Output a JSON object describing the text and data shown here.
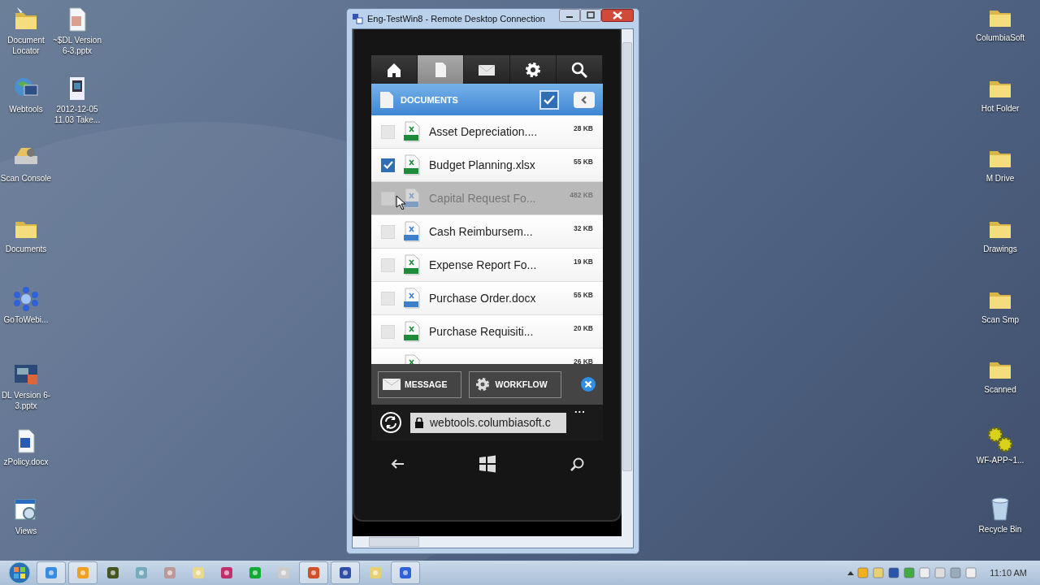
{
  "desktop_icons_left": [
    {
      "label": "Document Locator",
      "kind": "folder-arrow"
    },
    {
      "label": "~$DL Version 6-3.pptx",
      "kind": "pptx-ghost"
    },
    {
      "label": "Webtools",
      "kind": "globe"
    },
    {
      "label": "2012-12-05 11.03 Take...",
      "kind": "video"
    },
    {
      "label": "Scan Console",
      "kind": "scanner"
    },
    {
      "label": "Documents",
      "kind": "folder"
    },
    {
      "label": "GoToWebi...",
      "kind": "flower"
    },
    {
      "label": "DL Version 6-3.pptx",
      "kind": "slides"
    },
    {
      "label": "zPolicy.docx",
      "kind": "word"
    },
    {
      "label": "Views",
      "kind": "views"
    }
  ],
  "desktop_icons_right": [
    {
      "label": "ColumbiaSoft",
      "kind": "folder"
    },
    {
      "label": "Hot Folder",
      "kind": "folder"
    },
    {
      "label": "M Drive",
      "kind": "folder"
    },
    {
      "label": "Drawings",
      "kind": "folder"
    },
    {
      "label": "Scan Smp",
      "kind": "folder"
    },
    {
      "label": "Scanned",
      "kind": "folder"
    },
    {
      "label": "WF-APP~1...",
      "kind": "gears"
    },
    {
      "label": "Recycle Bin",
      "kind": "bin"
    }
  ],
  "window": {
    "title": "Eng-TestWin8 - Remote Desktop Connection",
    "phone": {
      "tabs": [
        {
          "kind": "home",
          "selected": false
        },
        {
          "kind": "document",
          "selected": true
        },
        {
          "kind": "mail",
          "selected": false
        },
        {
          "kind": "gear",
          "selected": false
        },
        {
          "kind": "search",
          "selected": false
        }
      ],
      "header": {
        "title": "DOCUMENTS",
        "select_all_checked": true
      },
      "files": [
        {
          "name": "Asset Depreciation....",
          "size": "28 KB",
          "kind": "xls",
          "checked": false,
          "highlighted": false
        },
        {
          "name": "Budget Planning.xlsx",
          "size": "55 KB",
          "kind": "xlsx",
          "checked": true,
          "highlighted": false
        },
        {
          "name": "Capital Request Fo...",
          "size": "482 KB",
          "kind": "docx",
          "checked": false,
          "highlighted": true
        },
        {
          "name": "Cash Reimbursem...",
          "size": "32 KB",
          "kind": "doc",
          "checked": false,
          "highlighted": false
        },
        {
          "name": "Expense Report Fo...",
          "size": "19 KB",
          "kind": "xls",
          "checked": false,
          "highlighted": false
        },
        {
          "name": "Purchase Order.docx",
          "size": "55 KB",
          "kind": "docx",
          "checked": false,
          "highlighted": false
        },
        {
          "name": "Purchase Requisiti...",
          "size": "20 KB",
          "kind": "xlsx",
          "checked": false,
          "highlighted": false
        },
        {
          "size": "26 KB",
          "kind": "xlsx",
          "highlighted": false
        }
      ],
      "actions": [
        {
          "label": "MESSAGE",
          "kind": "mail"
        },
        {
          "label": "WORKFLOW",
          "kind": "gear"
        }
      ],
      "address": {
        "url": "webtools.columbiasoft.c",
        "more": "..."
      }
    }
  },
  "taskbar": {
    "items": [
      {
        "kind": "ie",
        "running": true
      },
      {
        "kind": "outlook",
        "running": true
      },
      {
        "kind": "chip",
        "running": false
      },
      {
        "kind": "magnifier",
        "running": false
      },
      {
        "kind": "network",
        "running": false
      },
      {
        "kind": "notes",
        "running": false
      },
      {
        "kind": "access",
        "running": false
      },
      {
        "kind": "terminal",
        "running": false
      },
      {
        "kind": "disc",
        "running": false
      },
      {
        "kind": "powerpoint",
        "running": true
      },
      {
        "kind": "rdp",
        "running": true
      },
      {
        "kind": "folder",
        "running": false
      },
      {
        "kind": "flower",
        "running": true
      }
    ],
    "tray": [
      {
        "kind": "outlook"
      },
      {
        "kind": "folder"
      },
      {
        "kind": "shield"
      },
      {
        "kind": "network"
      },
      {
        "kind": "flag"
      },
      {
        "kind": "battery"
      },
      {
        "kind": "monitor"
      },
      {
        "kind": "speaker"
      }
    ],
    "clock": "11:10 AM"
  }
}
